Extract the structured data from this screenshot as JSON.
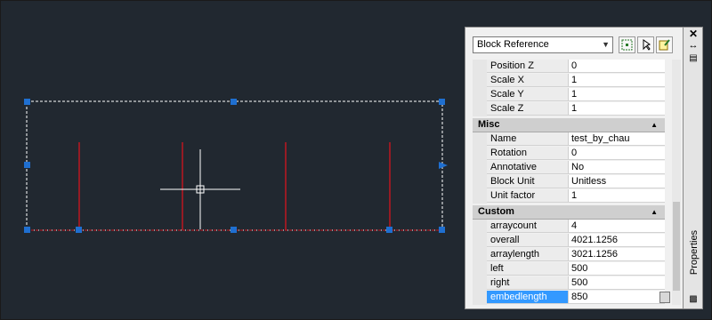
{
  "colors": {
    "background": "#212830",
    "grip": "#1f6fd0",
    "selection_dash": "#ffffff",
    "geometry_red": "#c8161f",
    "crosshair": "#ffffff",
    "panel": "#f0f0f0",
    "selected_row": "#3399ff"
  },
  "panel": {
    "dropdown_value": "Block Reference",
    "toolbar_icons": [
      "quick-select-icon",
      "select-objects-icon",
      "toggle-pickadd-icon"
    ],
    "rows_top": [
      {
        "name": "Position Z",
        "value": "0"
      },
      {
        "name": "Scale X",
        "value": "1"
      },
      {
        "name": "Scale Y",
        "value": "1"
      },
      {
        "name": "Scale Z",
        "value": "1"
      }
    ],
    "misc": {
      "title": "Misc",
      "rows": [
        {
          "name": "Name",
          "value": "test_by_chau"
        },
        {
          "name": "Rotation",
          "value": "0"
        },
        {
          "name": "Annotative",
          "value": "No"
        },
        {
          "name": "Block Unit",
          "value": "Unitless"
        },
        {
          "name": "Unit factor",
          "value": "1"
        }
      ]
    },
    "custom": {
      "title": "Custom",
      "rows": [
        {
          "name": "arraycount",
          "value": "4"
        },
        {
          "name": "overall",
          "value": "4021.1256"
        },
        {
          "name": "arraylength",
          "value": "3021.1256"
        },
        {
          "name": "left",
          "value": "500"
        },
        {
          "name": "right",
          "value": "500"
        },
        {
          "name": "embedlength",
          "value": "850",
          "selected": true
        }
      ]
    }
  },
  "side": {
    "label": "Properties",
    "icons": [
      "close-icon",
      "autohide-icon",
      "panel-menu-icon"
    ]
  }
}
